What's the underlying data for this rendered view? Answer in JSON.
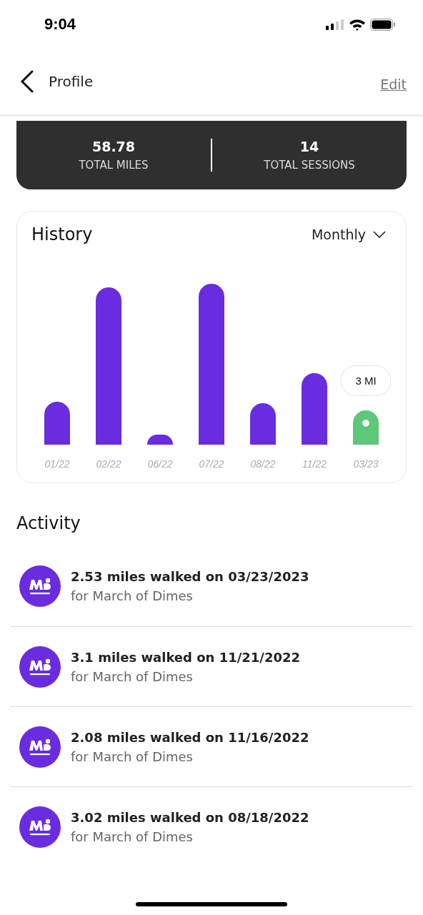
{
  "status_bar": {
    "time": "9:04"
  },
  "nav": {
    "back_label": "Profile",
    "action": "Edit"
  },
  "stats": [
    {
      "value": "58.78",
      "label": "TOTAL MILES"
    },
    {
      "value": "14",
      "label": "TOTAL SESSIONS"
    }
  ],
  "history": {
    "title": "History",
    "period": "Monthly",
    "tooltip": "3 MI",
    "bars": [
      {
        "label": "01/22",
        "selected": false
      },
      {
        "label": "02/22",
        "selected": false
      },
      {
        "label": "06/22",
        "selected": false
      },
      {
        "label": "07/22",
        "selected": false
      },
      {
        "label": "08/22",
        "selected": false
      },
      {
        "label": "11/22",
        "selected": false
      },
      {
        "label": "03/23",
        "selected": true
      }
    ]
  },
  "activity": {
    "title": "Activity",
    "items": [
      {
        "title": "2.53 miles walked on 03/23/2023",
        "subtitle": "for March of Dimes"
      },
      {
        "title": "3.1 miles walked on 11/21/2022",
        "subtitle": "for March of Dimes"
      },
      {
        "title": "2.08 miles walked on 11/16/2022",
        "subtitle": "for March of Dimes"
      },
      {
        "title": "3.02 miles walked on 08/18/2022",
        "subtitle": "for March of Dimes"
      }
    ]
  }
}
